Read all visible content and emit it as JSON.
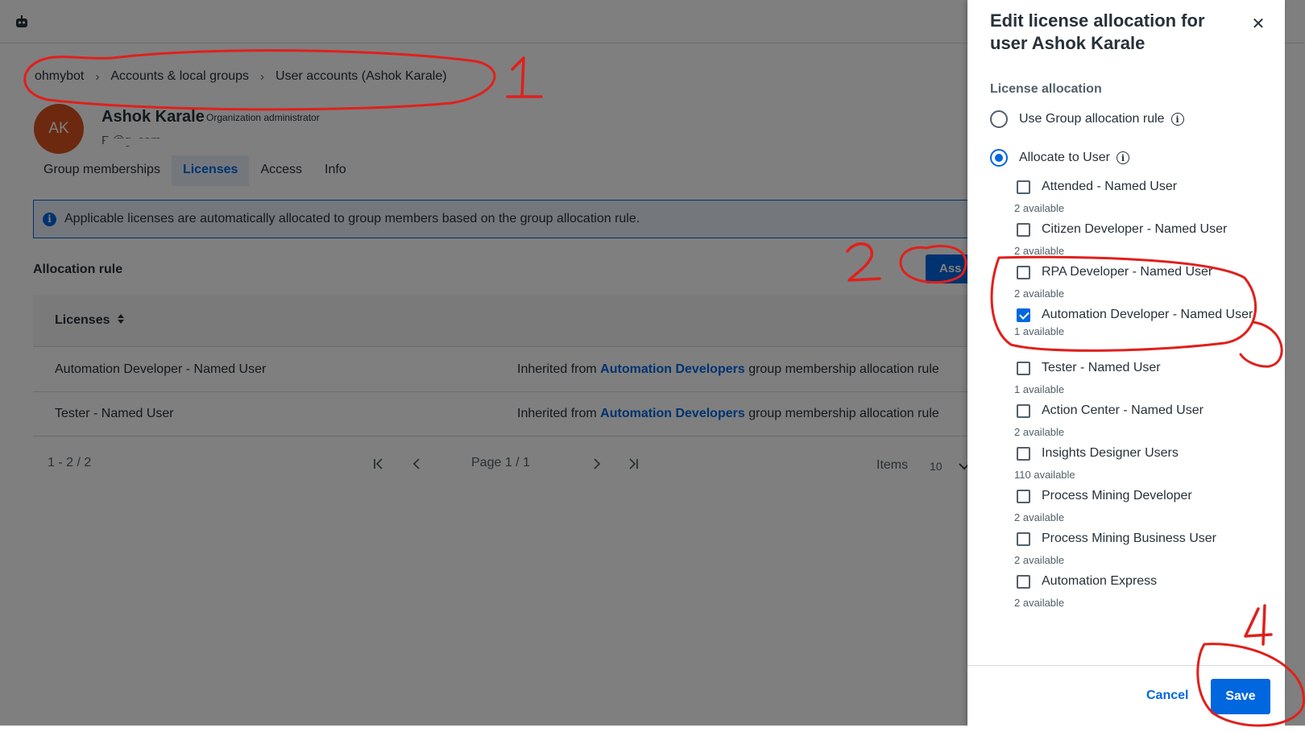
{
  "header": {
    "logo_icon": "robot-icon"
  },
  "breadcrumb": {
    "items": [
      "ohmybot",
      "Accounts & local groups",
      "User accounts (Ashok Karale)"
    ],
    "separator": "›"
  },
  "user": {
    "initials": "AK",
    "name": "Ashok Karale",
    "role": "Organization administrator",
    "email_fragment": "F              @g      .com"
  },
  "tabs": [
    "Group memberships",
    "Licenses",
    "Access",
    "Info"
  ],
  "banner": {
    "icon": "info-icon",
    "text": "Applicable licenses are automatically allocated to group members based on the group allocation rule."
  },
  "allocation": {
    "title": "Allocation rule",
    "assign_label": "Ass",
    "column_header": "Licenses",
    "sort_icon": "sort-icon",
    "rows": [
      {
        "license": "Automation Developer - Named User",
        "prefix": "Inherited from ",
        "group": "Automation Developers",
        "suffix": " group membership allocation rule"
      },
      {
        "license": "Tester - Named User",
        "prefix": "Inherited from ",
        "group": "Automation Developers",
        "suffix": " group membership allocation rule"
      }
    ]
  },
  "pager": {
    "range": "1 - 2 / 2",
    "page": "Page 1 / 1",
    "items_label": "Items",
    "items_value": "10"
  },
  "panel": {
    "title": "Edit license allocation for user Ashok Karale",
    "section": "License allocation",
    "option_group": "Use Group allocation rule",
    "option_user": "Allocate to User",
    "selected_option": "Allocate to User",
    "licenses": [
      {
        "name": "Attended - Named User",
        "available": "2 available",
        "checked": false
      },
      {
        "name": "Citizen Developer - Named User",
        "available": "2 available",
        "checked": false
      },
      {
        "name": "RPA Developer - Named User",
        "available": "2 available",
        "checked": false
      },
      {
        "name": "Automation Developer - Named User",
        "available": "1 available",
        "checked": true
      },
      {
        "name": "Tester - Named User",
        "available": "1 available",
        "checked": false
      },
      {
        "name": "Action Center - Named User",
        "available": "2 available",
        "checked": false
      },
      {
        "name": "Insights Designer Users",
        "available": "110 available",
        "checked": false
      },
      {
        "name": "Process Mining Developer",
        "available": "2 available",
        "checked": false
      },
      {
        "name": "Process Mining Business User",
        "available": "2 available",
        "checked": false
      },
      {
        "name": "Automation Express",
        "available": "2 available",
        "checked": false
      }
    ],
    "cancel_label": "Cancel",
    "save_label": "Save"
  },
  "annotations": {
    "labels": [
      "1",
      "2",
      "3",
      "4"
    ],
    "color": "#e0201c"
  },
  "colors": {
    "accent": "#0067df",
    "avatar": "#d9531e",
    "overlay": "rgba(0,0,0,0.5)"
  }
}
